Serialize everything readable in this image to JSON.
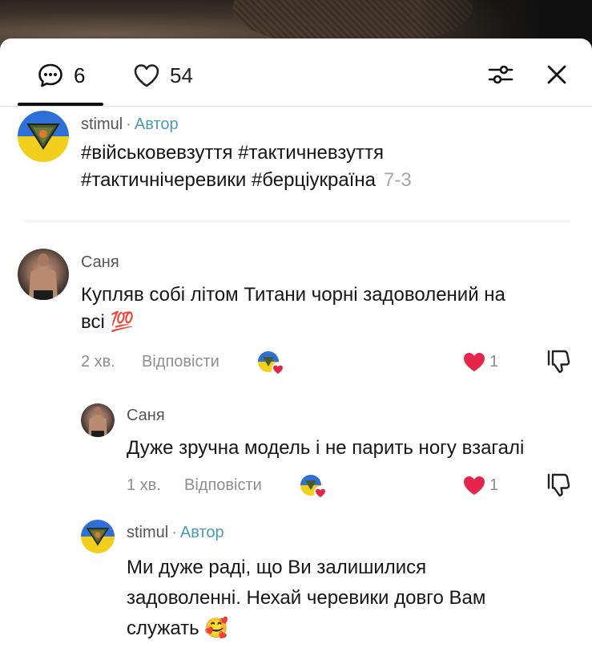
{
  "header": {
    "comments_count": "6",
    "likes_count": "54"
  },
  "icons": {
    "comment": "comment-bubble-icon",
    "like": "heart-outline-icon",
    "filter": "sliders-icon",
    "close": "close-icon",
    "liked": "heart-filled-icon",
    "dislike": "thumbs-down-icon",
    "creator_liked": "creator-liked-badge-icon"
  },
  "colors": {
    "heart": "#e5264a",
    "author": "#4b9ab3",
    "muted": "#8e8e8e",
    "ua_blue": "#2f6fd8",
    "ua_yellow": "#f3cf1d"
  },
  "comments": [
    {
      "username": "stimul",
      "separator": "·",
      "badge": "Автор",
      "text_line1": "#військовевзуття #тактичневзуття",
      "text_line2": "#тактичнічеревики #берціукраїна",
      "date": "7-3"
    },
    {
      "username": "Саня",
      "text_line1": "Купляв собі літом Титани чорні задоволений на",
      "text_line2": "всі",
      "emoji": "💯",
      "time": "2 хв.",
      "reply_label": "Відповісти",
      "likes": "1"
    },
    {
      "username": "Саня",
      "text_line1": "Дуже зручна модель і не парить ногу взагалі",
      "time": "1 хв.",
      "reply_label": "Відповісти",
      "likes": "1"
    },
    {
      "username": "stimul",
      "separator": "·",
      "badge": "Автор",
      "text_line1": "Ми дуже раді, що Ви залишилися",
      "text_line2": "задоволенні. Нехай черевики довго Вам",
      "text_line3": "служать",
      "emoji": "🥰"
    }
  ]
}
